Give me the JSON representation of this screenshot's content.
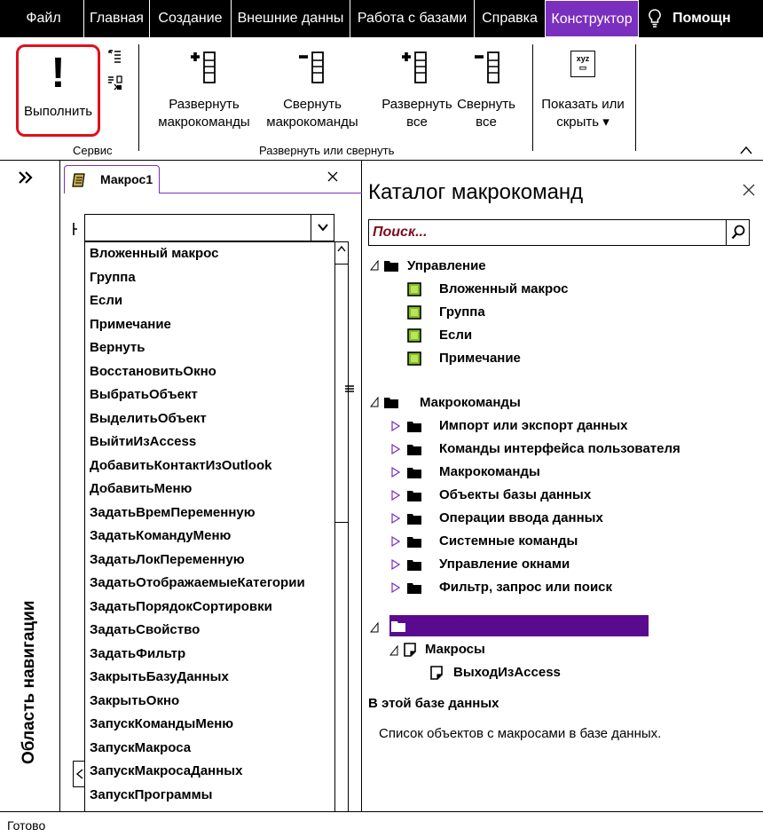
{
  "tabs": [
    {
      "id": "file",
      "label": "Файл"
    },
    {
      "id": "home",
      "label": "Главная"
    },
    {
      "id": "create",
      "label": "Создание"
    },
    {
      "id": "external",
      "label": "Внешние данны"
    },
    {
      "id": "dbtools",
      "label": "Работа с базами"
    },
    {
      "id": "help",
      "label": "Справка"
    },
    {
      "id": "design",
      "label": "Конструктор"
    }
  ],
  "tell_me": {
    "label": "Помощн"
  },
  "ribbon": {
    "run_label": "Выполнить",
    "service_group": "Сервис",
    "expand_actions": "Развернуть\nмакрокоманды",
    "collapse_actions": "Свернуть\nмакрокоманды",
    "expand_all": "Развернуть\nвсе",
    "collapse_all": "Свернуть\nвсе",
    "expand_group": "Развернуть или свернуть",
    "show_hide": "Показать или\nскрыть ▾",
    "show_hide_icon_text": "xyz"
  },
  "nav": {
    "title": "Область навигации"
  },
  "status": {
    "text": "Готово"
  },
  "document": {
    "tab_label": "Макрос1",
    "dropdown_items": [
      "Вложенный макрос",
      "Группа",
      "Если",
      "Примечание",
      "Вернуть",
      "ВосстановитьОкно",
      "ВыбратьОбъект",
      "ВыделитьОбъект",
      "ВыйтиИзAccess",
      "ДобавитьКонтактИзOutlook",
      "ДобавитьМеню",
      "ЗадатьВремПеременную",
      "ЗадатьКомандуМеню",
      "ЗадатьЛокПеременную",
      "ЗадатьОтображаемыеКатегории",
      "ЗадатьПорядокСортировки",
      "ЗадатьСвойство",
      "ЗадатьФильтр",
      "ЗакрытьБазуДанных",
      "ЗакрытьОкно",
      "ЗапускКомандыМеню",
      "ЗапускМакроса",
      "ЗапускМакросаДанных",
      "ЗапускПрограммы"
    ]
  },
  "catalog": {
    "title": "Каталог макрокоманд",
    "search_placeholder": "Поиск...",
    "control_flow": {
      "label": "Управление",
      "items": [
        "Вложенный макрос",
        "Группа",
        "Если",
        "Примечание"
      ]
    },
    "actions": {
      "label": "Макрокоманды",
      "items": [
        "Импорт или экспорт данных",
        "Команды интерфейса пользователя",
        "Макрокоманды",
        "Объекты базы данных",
        "Операции ввода данных",
        "Системные команды",
        "Управление окнами",
        "Фильтр, запрос или поиск"
      ]
    },
    "in_db": {
      "label": "В этой базе данных",
      "macros_label": "Макросы",
      "macro_item": "ВыходИзAccess"
    },
    "description": {
      "title": "В этой базе данных",
      "text": "Список объектов с макросами в базе данных."
    }
  },
  "colors": {
    "accent": "#7b2fbe",
    "selection": "#5a0a8f",
    "highlight": "#e0101c",
    "macro_icon_fill": "#7fbf1f",
    "search_placeholder": "#7a0f1c"
  }
}
